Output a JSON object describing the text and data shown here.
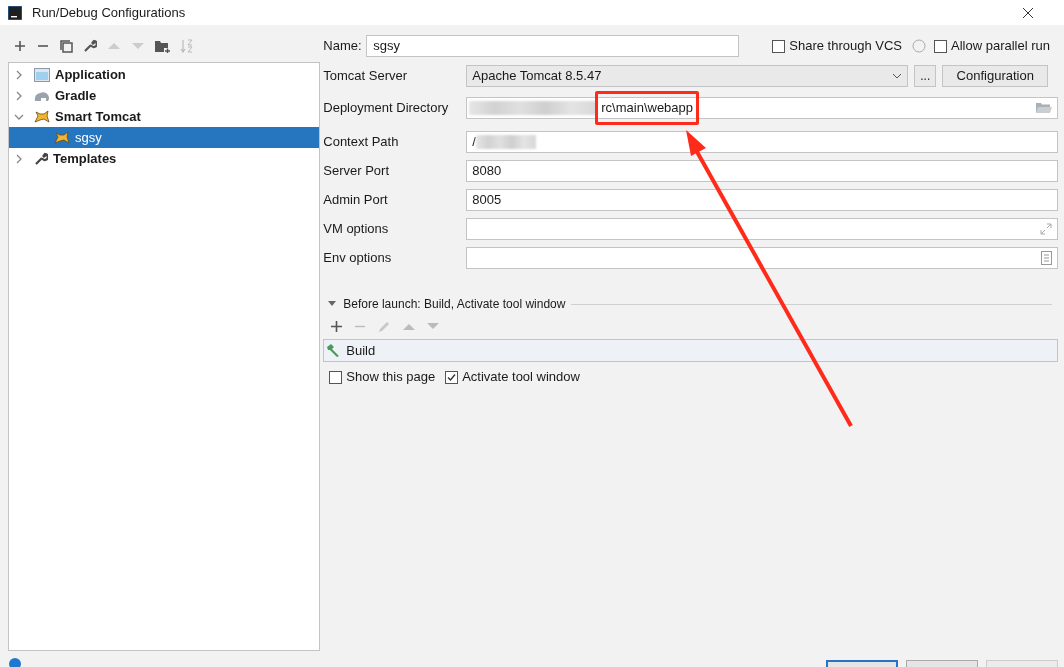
{
  "window": {
    "title": "Run/Debug Configurations"
  },
  "tree": [
    {
      "label": "Application",
      "kind": "application",
      "expanded": false,
      "selected": false
    },
    {
      "label": "Gradle",
      "kind": "gradle",
      "expanded": false,
      "selected": false
    },
    {
      "label": "Smart Tomcat",
      "kind": "tomcat",
      "expanded": true,
      "selected": false,
      "children": [
        {
          "label": "sgsy",
          "kind": "tomcat",
          "selected": true
        }
      ]
    },
    {
      "label": "Templates",
      "kind": "templates",
      "expanded": false,
      "selected": false
    }
  ],
  "name_field": {
    "label": "Name:",
    "value": "sgsy"
  },
  "options": [
    {
      "label": "Share through VCS",
      "checked": false,
      "help": true
    },
    {
      "label": "Allow parallel run",
      "checked": false,
      "help": false
    }
  ],
  "fields": [
    {
      "label": "Tomcat Server",
      "kind": "select",
      "value": "Apache Tomcat 8.5.47",
      "extra": "...",
      "button": "Configuration"
    },
    {
      "label": "Deployment Directory",
      "kind": "path",
      "value": "rc\\main\\webapp",
      "redacted": true
    },
    {
      "label": "Context Path",
      "kind": "text",
      "value": "/",
      "redacted": true
    },
    {
      "label": "Server Port",
      "kind": "text",
      "value": "8080"
    },
    {
      "label": "Admin Port",
      "kind": "text",
      "value": "8005"
    },
    {
      "label": "VM options",
      "kind": "expand"
    },
    {
      "label": "Env options",
      "kind": "list"
    }
  ],
  "before_launch": {
    "title": "Before launch: Build, Activate tool window",
    "expanded": true,
    "tasks": [
      {
        "label": "Build"
      }
    ]
  },
  "launch_options": [
    {
      "label": "Show this page",
      "checked": false
    },
    {
      "label": "Activate tool window",
      "checked": true
    }
  ]
}
